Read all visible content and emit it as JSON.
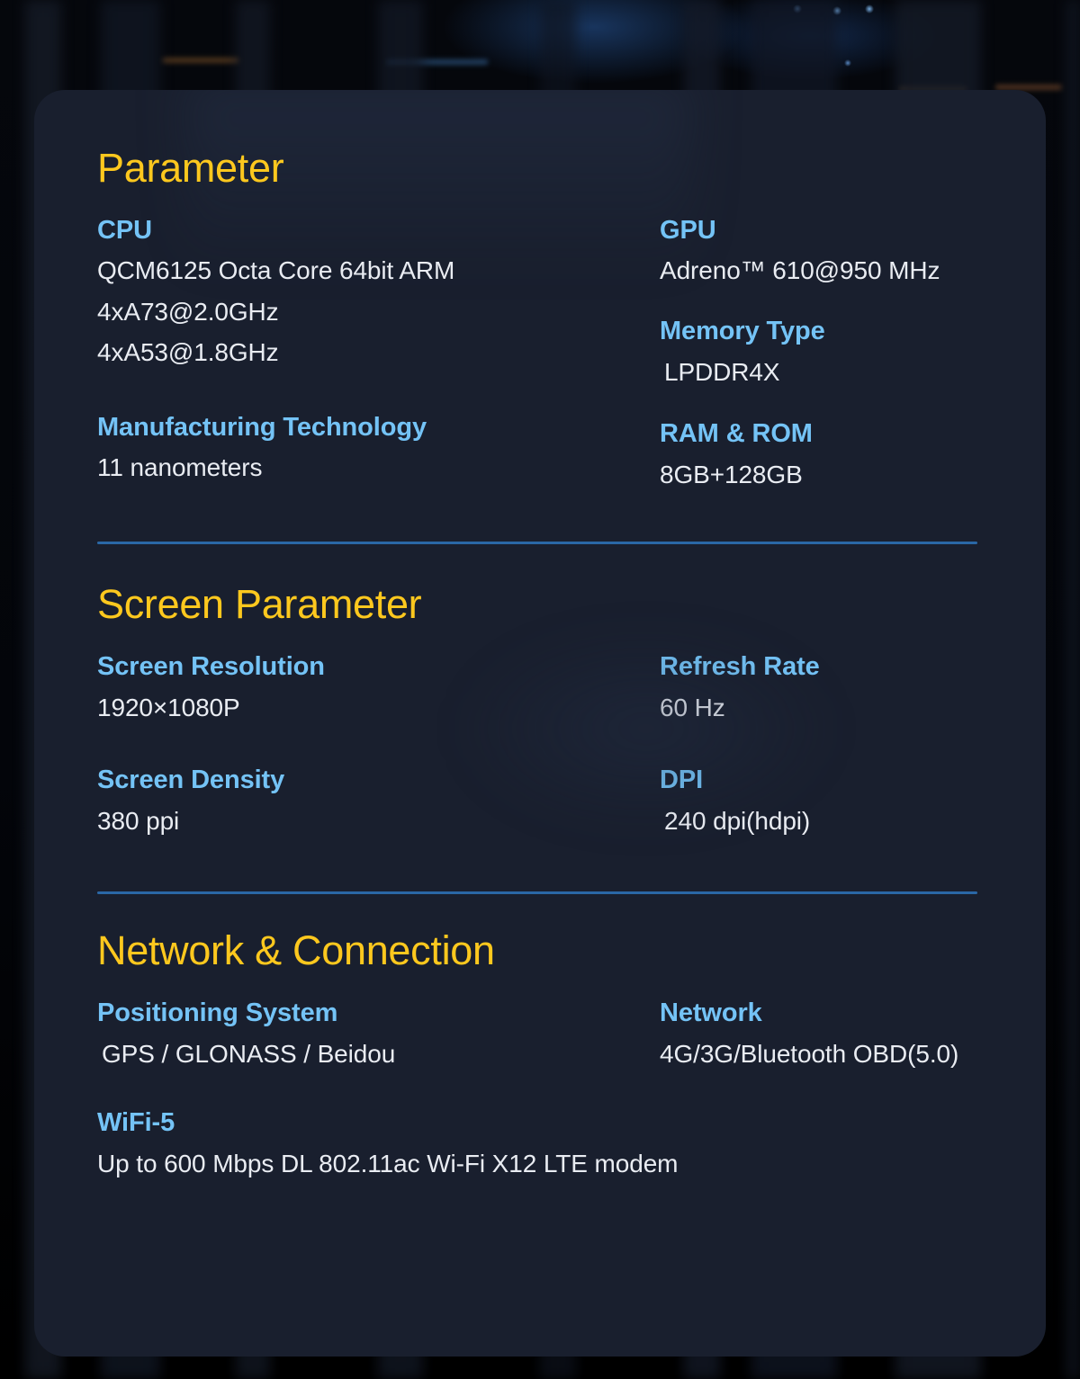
{
  "theme": {
    "card_background": "#191F2E",
    "page_background": "#000000",
    "section_title_color": "#FDC81E",
    "field_label_color": "#74C3F6",
    "field_value_color": "#E9ECF2",
    "divider_color": "#2A67A6"
  },
  "sections": [
    {
      "id": "parameter",
      "title": "Parameter",
      "rows": [
        {
          "left": {
            "label": "CPU",
            "values": [
              "QCM6125 Octa Core 64bit ARM",
              "4xA73@2.0GHz",
              "4xA53@1.8GHz"
            ]
          },
          "right": {
            "label": "GPU",
            "values": [
              "Adreno™ 610@950 MHz"
            ]
          }
        },
        {
          "left": {
            "label": "",
            "values": []
          },
          "right": {
            "label": "Memory Type",
            "values": [
              "LPDDR4X"
            ]
          }
        },
        {
          "left": {
            "label": "Manufacturing Technology",
            "values": [
              "11 nanometers"
            ]
          },
          "right": {
            "label": "RAM & ROM",
            "values": [
              "8GB+128GB"
            ]
          }
        }
      ]
    },
    {
      "id": "screen",
      "title": "Screen Parameter",
      "rows": [
        {
          "left": {
            "label": "Screen Resolution",
            "values": [
              "1920×1080P"
            ]
          },
          "right": {
            "label": "Refresh Rate",
            "values": [
              "60 Hz"
            ]
          }
        },
        {
          "left": {
            "label": "Screen Density",
            "values": [
              "380 ppi"
            ]
          },
          "right": {
            "label": "DPI",
            "values": [
              "240 dpi(hdpi)"
            ]
          }
        }
      ]
    },
    {
      "id": "network",
      "title": "Network & Connection",
      "rows": [
        {
          "left": {
            "label": "Positioning System",
            "values": [
              "GPS / GLONASS / Beidou"
            ]
          },
          "right": {
            "label": "Network",
            "values": [
              "4G/3G/Bluetooth OBD(5.0)"
            ]
          }
        },
        {
          "left": {
            "label": "WiFi-5",
            "values": [
              "Up to 600 Mbps DL 802.11ac Wi-Fi X12 LTE modem"
            ]
          },
          "right": {
            "label": "",
            "values": []
          }
        }
      ]
    }
  ],
  "fields": {
    "cpu_label": "CPU",
    "cpu_v1": "QCM6125 Octa Core 64bit ARM",
    "cpu_v2": "4xA73@2.0GHz",
    "cpu_v3": "4xA53@1.8GHz",
    "gpu_label": "GPU",
    "gpu_v1": "Adreno™ 610@950 MHz",
    "memtype_label": "Memory Type",
    "memtype_v1": "LPDDR4X",
    "mfg_label": "Manufacturing Technology",
    "mfg_v1": "11 nanometers",
    "ramrom_label": "RAM & ROM",
    "ramrom_v1": "8GB+128GB",
    "res_label": "Screen Resolution",
    "res_v1": "1920×1080P",
    "refresh_label": "Refresh Rate",
    "refresh_v1": "60 Hz",
    "density_label": "Screen Density",
    "density_v1": "380 ppi",
    "dpi_label": "DPI",
    "dpi_v1": "240 dpi(hdpi)",
    "positioning_label": "Positioning System",
    "positioning_v1": "GPS / GLONASS / Beidou",
    "network_label": "Network",
    "network_v1": "4G/3G/Bluetooth OBD(5.0)",
    "wifi_label": "WiFi-5",
    "wifi_v1": "Up to 600 Mbps DL 802.11ac Wi-Fi X12 LTE modem"
  },
  "titles": {
    "parameter": "Parameter",
    "screen": "Screen Parameter",
    "network": "Network & Connection"
  }
}
